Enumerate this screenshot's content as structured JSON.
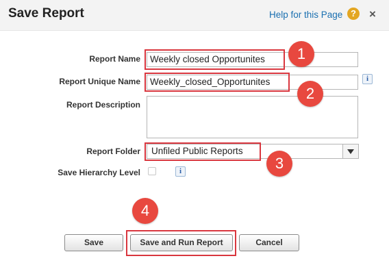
{
  "dialog": {
    "title": "Save Report",
    "help_link": "Help for this Page",
    "help_icon": "?",
    "close_icon": "×"
  },
  "form": {
    "report_name": {
      "label": "Report Name",
      "value": "Weekly closed Opportunites"
    },
    "report_unique_name": {
      "label": "Report Unique Name",
      "value": "Weekly_closed_Opportunites"
    },
    "report_description": {
      "label": "Report Description",
      "value": ""
    },
    "report_folder": {
      "label": "Report Folder",
      "value": "Unfiled Public Reports"
    },
    "save_hierarchy_level": {
      "label": "Save Hierarchy Level",
      "checked": false
    },
    "info_icon": "i"
  },
  "buttons": {
    "save": "Save",
    "save_and_run": "Save and Run Report",
    "cancel": "Cancel"
  },
  "callouts": [
    "1",
    "2",
    "3",
    "4"
  ],
  "colors": {
    "highlight": "#d9363e",
    "badge": "#e8483f",
    "link": "#1a6fb0",
    "help_icon": "#e3a622"
  }
}
